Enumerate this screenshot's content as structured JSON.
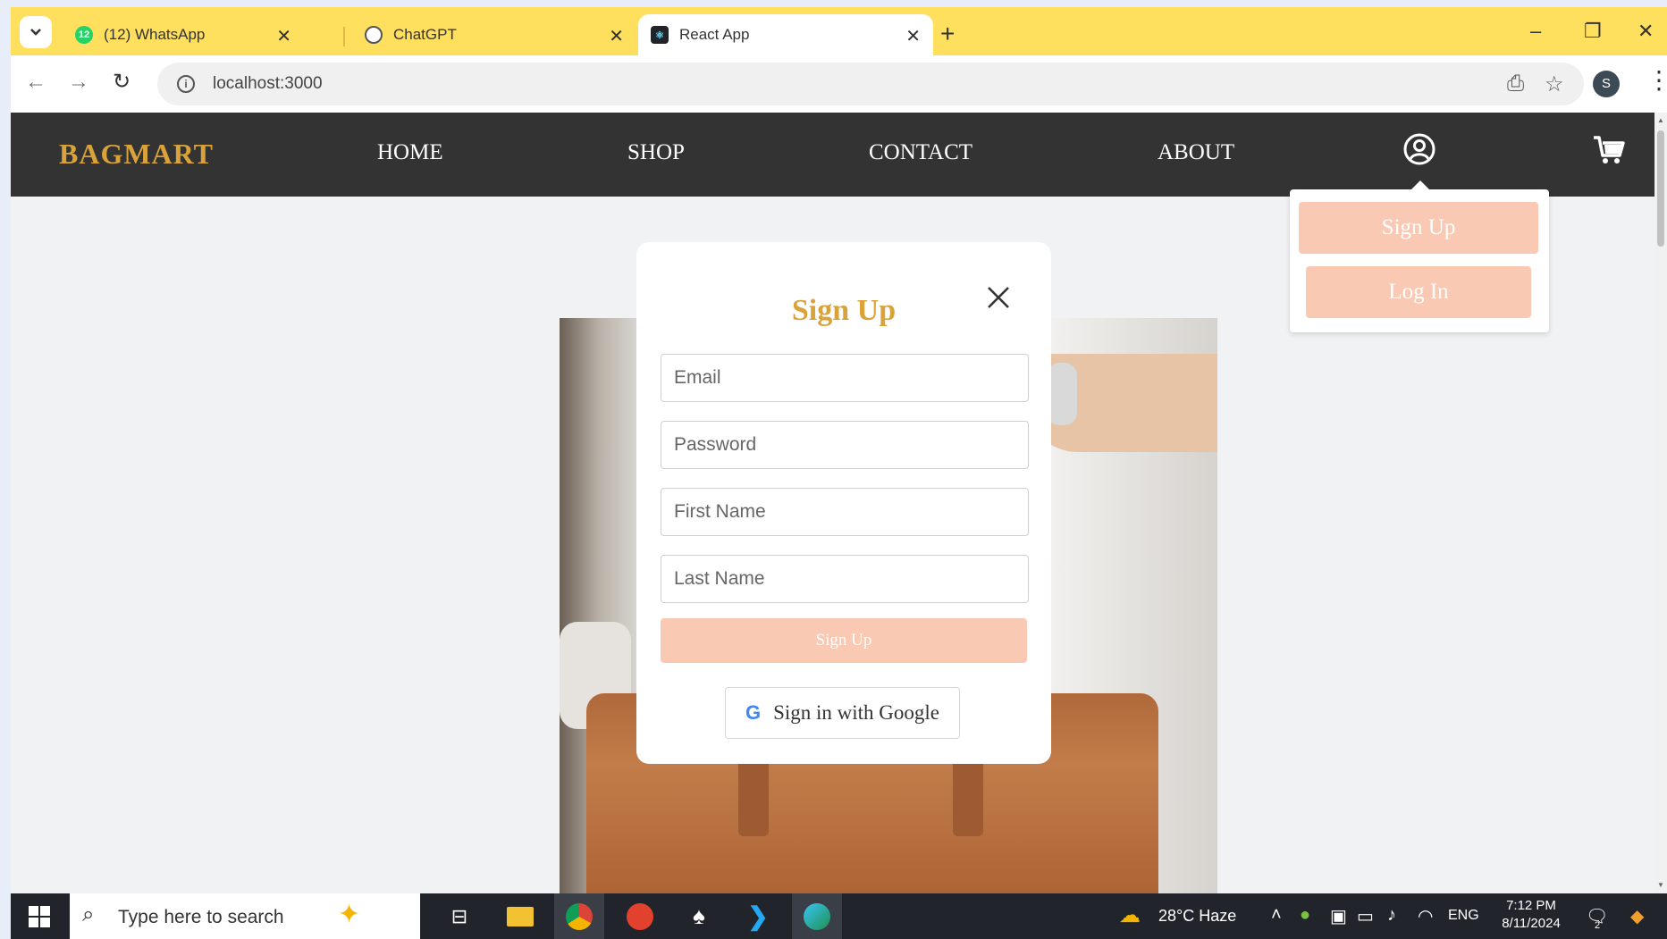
{
  "browser": {
    "tabs": [
      {
        "label": "(12) WhatsApp",
        "badge": "12",
        "icon": "whatsapp-icon"
      },
      {
        "label": "ChatGPT",
        "icon": "chatgpt-icon"
      },
      {
        "label": "React App",
        "icon": "react-icon"
      }
    ],
    "url": "localhost:3000",
    "profile_initial": "S"
  },
  "site": {
    "brand": "BAGMART",
    "nav": [
      "HOME",
      "SHOP",
      "CONTACT",
      "ABOUT"
    ],
    "accent_color": "#d9a33a",
    "button_color": "#fac9b3",
    "navbar_color": "#333333"
  },
  "account_menu": {
    "signup_label": "Sign Up",
    "login_label": "Log In"
  },
  "modal": {
    "title": "Sign Up",
    "fields": [
      {
        "placeholder": "Email",
        "value": ""
      },
      {
        "placeholder": "Password",
        "value": ""
      },
      {
        "placeholder": "First Name",
        "value": ""
      },
      {
        "placeholder": "Last Name",
        "value": ""
      }
    ],
    "submit_label": "Sign Up",
    "google_label": "Sign in with Google",
    "google_icon_letter": "G"
  },
  "taskbar": {
    "search_placeholder": "Type here to search",
    "weather": "28°C  Haze",
    "language": "ENG",
    "time": "7:12 PM",
    "date": "8/11/2024",
    "notification_count": "2"
  }
}
